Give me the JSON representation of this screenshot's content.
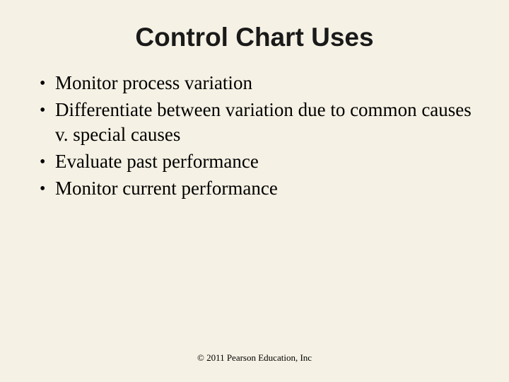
{
  "title": "Control Chart Uses",
  "bullets": [
    "Monitor process variation",
    "Differentiate between variation due to common causes v. special causes",
    "Evaluate past performance",
    "Monitor current performance"
  ],
  "marker": "•",
  "footer": "© 2011 Pearson Education, Inc"
}
